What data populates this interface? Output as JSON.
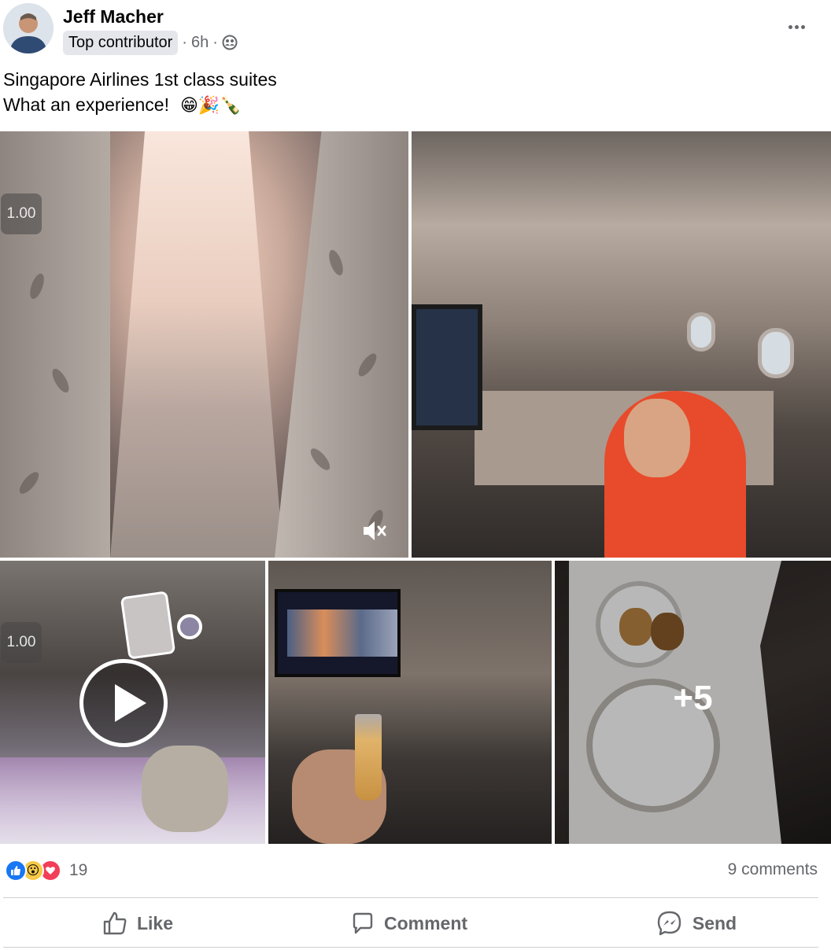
{
  "post": {
    "author": "Jeff Macher",
    "badge": "Top contributor",
    "time": "6h",
    "separator": "·",
    "audience_icon": "friends-icon",
    "more_icon": "more-dots-icon",
    "text_line1": "Singapore Airlines 1st class suites",
    "text_line2": "What an experience!",
    "emojis": "😁🎉🍾"
  },
  "media": {
    "video1_speed": "1.00",
    "video2_speed": "1.00",
    "more_count": "+5"
  },
  "reactions": {
    "like_icon": "👍",
    "wow_icon": "😮",
    "love_icon": "♥",
    "count": "19",
    "comments": "9 comments"
  },
  "actions": {
    "like": "Like",
    "comment": "Comment",
    "send": "Send"
  },
  "colors": {
    "text_primary": "#050505",
    "text_secondary": "#65676b",
    "badge_bg": "#e4e6eb",
    "like_blue": "#1877f2",
    "love_red": "#f33e58",
    "wow_yellow": "#f7c948",
    "divider": "#ced0d4"
  }
}
